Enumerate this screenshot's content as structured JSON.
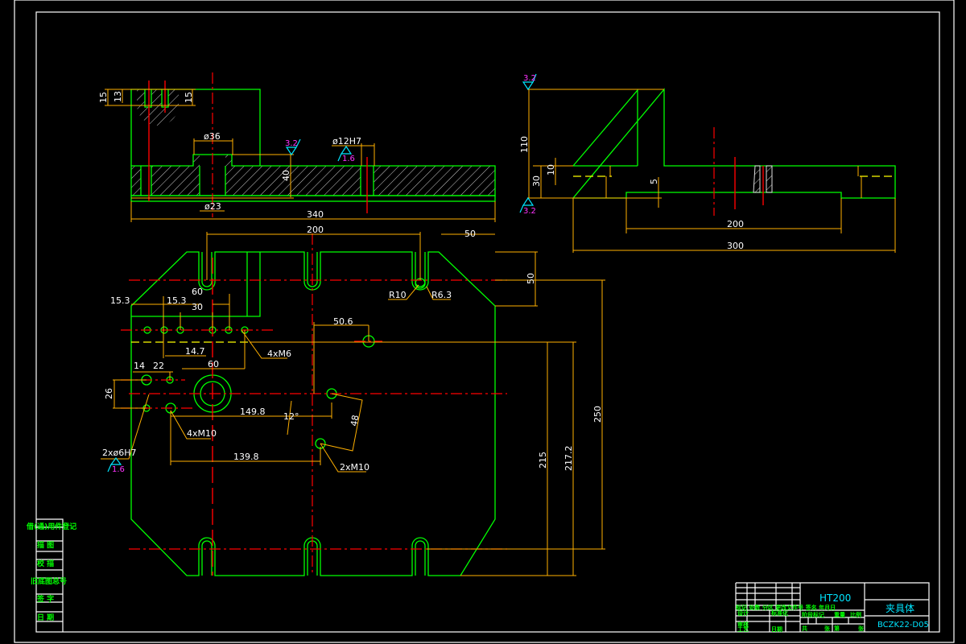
{
  "colors": {
    "background": "#000000",
    "outline": "#00ff00",
    "dimension": "#ffb000",
    "centerline": "#ff0000",
    "frame": "#ffffff",
    "surface_symbol": "#00e5ff",
    "roughness_value": "#ff33ff"
  },
  "section_view": {
    "dims": [
      "15",
      "13",
      "15",
      "ø36",
      "ø23",
      "40",
      "ø12H7",
      "340"
    ],
    "roughness": [
      "3.2",
      "1.6"
    ]
  },
  "side_view": {
    "dims": [
      "110",
      "30",
      "10",
      "5",
      "200",
      "300"
    ],
    "roughness": [
      "3.2",
      "3.2"
    ]
  },
  "plan_view": {
    "dims": [
      "200",
      "50",
      "50",
      "R10",
      "R6.3",
      "15.3",
      "15.3",
      "60",
      "30",
      "14.7",
      "60",
      "4xM6",
      "50.6",
      "14",
      "22",
      "26",
      "4xM10",
      "149.8",
      "12°",
      "48",
      "2xø6H7",
      "139.8",
      "2xM10",
      "250",
      "217.2",
      "215"
    ],
    "roughness": [
      "1.6"
    ]
  },
  "left_block": [
    "借(通)用件登记",
    "描 图",
    "校 描",
    "旧底图总号",
    "签 字",
    "日 期"
  ],
  "title_block": {
    "material": "HT200",
    "part_name": "夹具体",
    "drawing_number": "BCZK22-D05",
    "row_labels": [
      "标记 处数 分区 更改文件号 签名 年月日",
      "设计",
      "标准化",
      "审核",
      "工艺",
      "日期"
    ],
    "mid_labels": [
      "阶段标记",
      "重量",
      "比例",
      "共",
      "张",
      "第",
      "张"
    ]
  }
}
